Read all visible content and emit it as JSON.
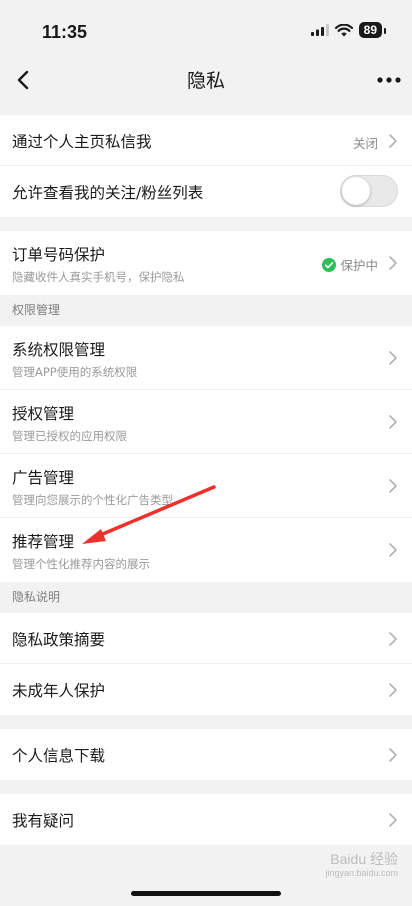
{
  "status_bar": {
    "time": "11:35",
    "battery": "89"
  },
  "header": {
    "title": "隐私"
  },
  "rows": {
    "message": {
      "title": "通过个人主页私信我",
      "value": "关闭"
    },
    "followers": {
      "title": "允许查看我的关注/粉丝列表",
      "toggle_on": false
    },
    "order_protect": {
      "title": "订单号码保护",
      "subtitle": "隐藏收件人真实手机号，保护隐私",
      "value": "保护中"
    },
    "system_perm": {
      "title": "系统权限管理",
      "subtitle": "管理APP使用的系统权限"
    },
    "auth": {
      "title": "授权管理",
      "subtitle": "管理已授权的应用权限"
    },
    "ads": {
      "title": "广告管理",
      "subtitle": "管理向您展示的个性化广告类型"
    },
    "recommend": {
      "title": "推荐管理",
      "subtitle": "管理个性化推荐内容的展示"
    },
    "policy_summary": {
      "title": "隐私政策摘要"
    },
    "minor": {
      "title": "未成年人保护"
    },
    "info_download": {
      "title": "个人信息下载"
    },
    "questions": {
      "title": "我有疑问"
    }
  },
  "sections": {
    "permissions": "权限管理",
    "privacy_notes": "隐私说明"
  },
  "watermark": {
    "text": "Baidu 经验",
    "url": "jingyan.baidu.com"
  },
  "colors": {
    "accent_green": "#2fbf58",
    "annotation_red": "#f0302a"
  }
}
